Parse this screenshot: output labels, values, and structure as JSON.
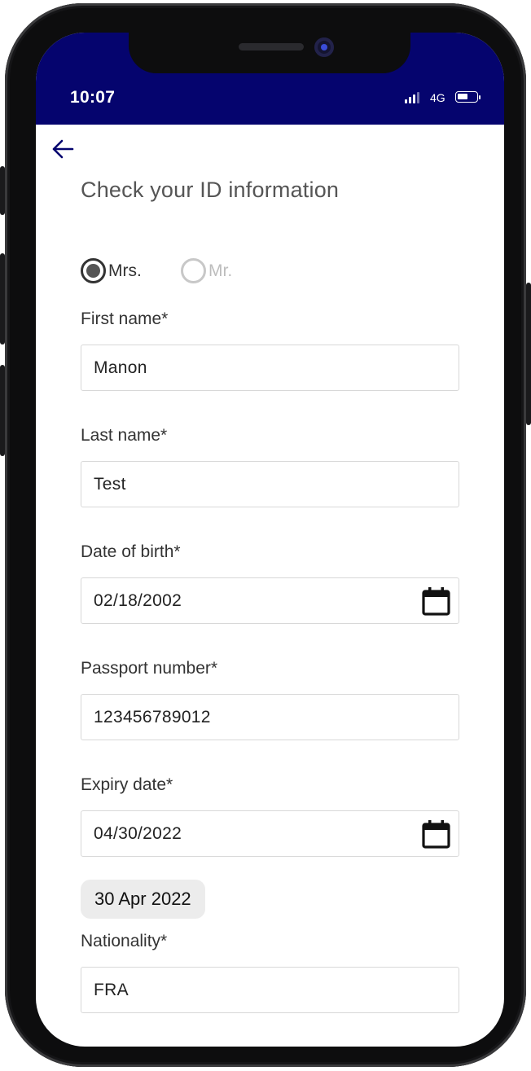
{
  "status_bar": {
    "time": "10:07",
    "network": "4G",
    "background_color": "#05046e"
  },
  "header": {
    "back_icon": "arrow-left-icon",
    "title": "Check your ID information"
  },
  "title_radio": {
    "options": [
      {
        "label": "Mrs.",
        "selected": true
      },
      {
        "label": "Mr.",
        "selected": false
      }
    ]
  },
  "form": {
    "first_name": {
      "label": "First name*",
      "value": "Manon"
    },
    "last_name": {
      "label": "Last name*",
      "value": "Test"
    },
    "date_of_birth": {
      "label": "Date of birth*",
      "value": "02/18/2002",
      "icon": "calendar-icon"
    },
    "passport_number": {
      "label": "Passport number*",
      "value": "123456789012"
    },
    "expiry_date": {
      "label": "Expiry date*",
      "value": "04/30/2022",
      "icon": "calendar-icon",
      "chip": "30 Apr 2022"
    },
    "nationality": {
      "label": "Nationality*",
      "value": "FRA"
    }
  },
  "colors": {
    "accent": "#05046e",
    "label_text": "#333333",
    "field_border": "#d8d8d8",
    "chip_background": "#ececec"
  }
}
